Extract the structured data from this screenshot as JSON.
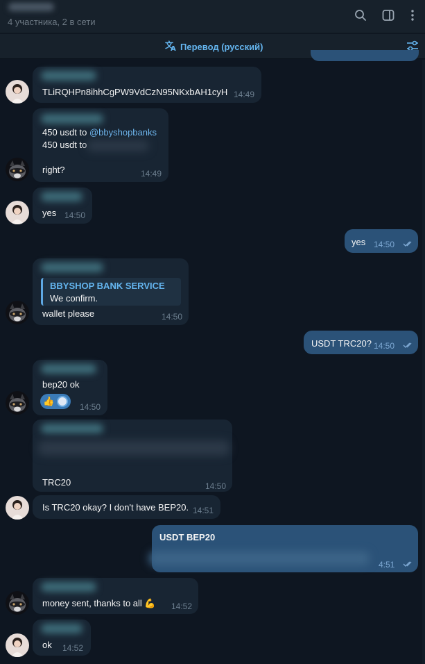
{
  "header": {
    "subtitle": "4 участника, 2 в сети",
    "icons": [
      "search-icon",
      "side-panel-icon",
      "more-icon"
    ]
  },
  "translate_bar": {
    "label": "Перевод (русский)",
    "icons": [
      "translate-icon",
      "settings-sliders-icon"
    ]
  },
  "messages": [
    {
      "dir": "in",
      "avatar": "girl",
      "text": "TLiRQHPn8ihhCgPW9VdCzN95NKxbAH1cyH",
      "time": "14:49"
    },
    {
      "dir": "in",
      "avatar": "raccoon",
      "line1_prefix": "450 usdt to ",
      "line1_link": "@bbyshopbanks",
      "line2": "450 usdt to",
      "line3": "right?",
      "time": "14:49"
    },
    {
      "dir": "in",
      "avatar": "girl",
      "text": "yes",
      "time": "14:50"
    },
    {
      "dir": "out",
      "text": "yes",
      "time": "14:50"
    },
    {
      "dir": "in",
      "avatar": "raccoon",
      "quote_title": "BBYSHOP BANK SERVICE",
      "quote_text": "We confirm.",
      "text": "wallet please",
      "time": "14:50"
    },
    {
      "dir": "out",
      "text": "USDT TRC20?",
      "time": "14:50"
    },
    {
      "dir": "in",
      "avatar": "raccoon",
      "text": "bep20 ok",
      "reaction": "👍",
      "time": "14:50"
    },
    {
      "dir": "in",
      "text": "TRC20",
      "time": "14:50"
    },
    {
      "dir": "in",
      "avatar": "girl",
      "text": "Is TRC20 okay? I don't have BEP20.",
      "time": "14:51"
    },
    {
      "dir": "out",
      "text": "USDT BEP20",
      "time": "4:51"
    },
    {
      "dir": "in",
      "avatar": "raccoon",
      "text": "money sent, thanks to all 💪",
      "time": "14:52"
    },
    {
      "dir": "in",
      "avatar": "girl",
      "text": "ok",
      "time": "14:52"
    }
  ],
  "colors": {
    "background": "#0e1621",
    "incoming_bubble": "#182533",
    "outgoing_bubble": "#2b5278",
    "accent": "#64b5ef"
  }
}
